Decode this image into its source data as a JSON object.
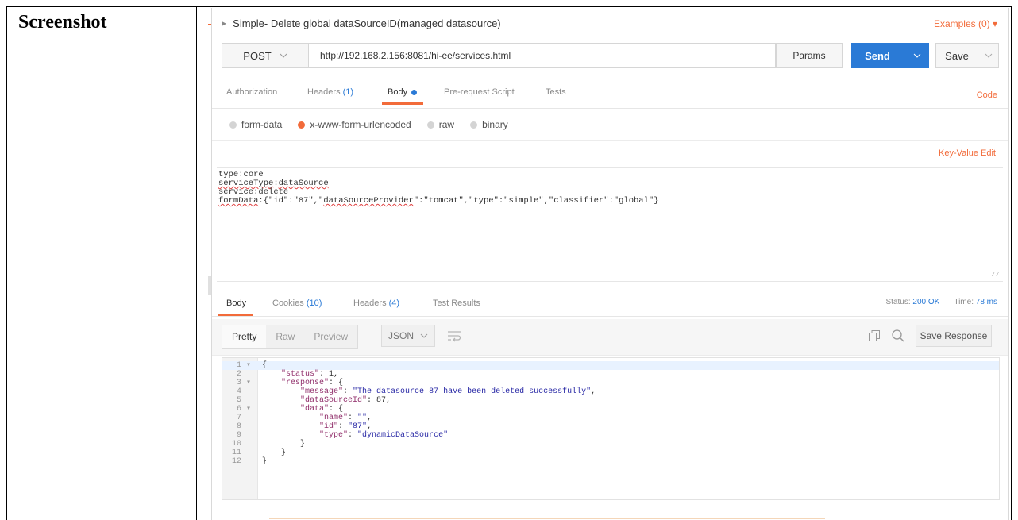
{
  "document": {
    "label": "Screenshot"
  },
  "request": {
    "title": "Simple- Delete global dataSourceID(managed datasource)",
    "examples": "Examples (0)",
    "method": "POST",
    "url": "http://192.168.2.156:8081/hi-ee/services.html",
    "params_label": "Params",
    "send_label": "Send",
    "save_label": "Save"
  },
  "request_tabs": [
    {
      "label": "Authorization",
      "count": ""
    },
    {
      "label": "Headers",
      "count": "(1)"
    },
    {
      "label": "Body",
      "count": ""
    },
    {
      "label": "Pre-request Script",
      "count": ""
    },
    {
      "label": "Tests",
      "count": ""
    }
  ],
  "code_link": "Code",
  "body_modes": [
    "form-data",
    "x-www-form-urlencoded",
    "raw",
    "binary"
  ],
  "body_mode_selected": "x-www-form-urlencoded",
  "kv_edit": "Key-Value Edit",
  "bulk_body": {
    "line1_key": "type",
    "line1_val": "core",
    "line2_key": "serviceType",
    "line2_val": "dataSource",
    "line3_key": "service",
    "line3_val": "delete",
    "line4_key": "formData",
    "line4_a": ":{\"id\":\"87\",\"",
    "line4_provider": "dataSourceProvider",
    "line4_b": "\":\"tomcat\",\"type\":\"simple\",\"classifier\":\"global\"}"
  },
  "response_tabs": [
    {
      "label": "Body",
      "count": ""
    },
    {
      "label": "Cookies",
      "count": "(10)"
    },
    {
      "label": "Headers",
      "count": "(4)"
    },
    {
      "label": "Test Results",
      "count": ""
    }
  ],
  "status": {
    "status_label": "Status:",
    "status_value": "200 OK",
    "time_label": "Time:",
    "time_value": "78 ms"
  },
  "view_modes": [
    "Pretty",
    "Raw",
    "Preview"
  ],
  "view_mode_selected": "Pretty",
  "format": "JSON",
  "save_response": "Save Response",
  "response_lines": [
    {
      "n": "1",
      "fold": "▾",
      "text": "{"
    },
    {
      "n": "2",
      "fold": "",
      "text": "    \"status\": 1,"
    },
    {
      "n": "3",
      "fold": "▾",
      "text": "    \"response\": {"
    },
    {
      "n": "4",
      "fold": "",
      "text": "        \"message\": \"The datasource 87 have been deleted successfully\","
    },
    {
      "n": "5",
      "fold": "",
      "text": "        \"dataSourceId\": 87,"
    },
    {
      "n": "6",
      "fold": "▾",
      "text": "        \"data\": {"
    },
    {
      "n": "7",
      "fold": "",
      "text": "            \"name\": \"\","
    },
    {
      "n": "8",
      "fold": "",
      "text": "            \"id\": \"87\","
    },
    {
      "n": "9",
      "fold": "",
      "text": "            \"type\": \"dynamicDataSource\""
    },
    {
      "n": "10",
      "fold": "",
      "text": "        }"
    },
    {
      "n": "11",
      "fold": "",
      "text": "    }"
    },
    {
      "n": "12",
      "fold": "",
      "text": "}"
    }
  ],
  "colors": {
    "accent": "#f26b3a",
    "send": "#2a7ad6",
    "link_count": "#2a7ad6"
  }
}
